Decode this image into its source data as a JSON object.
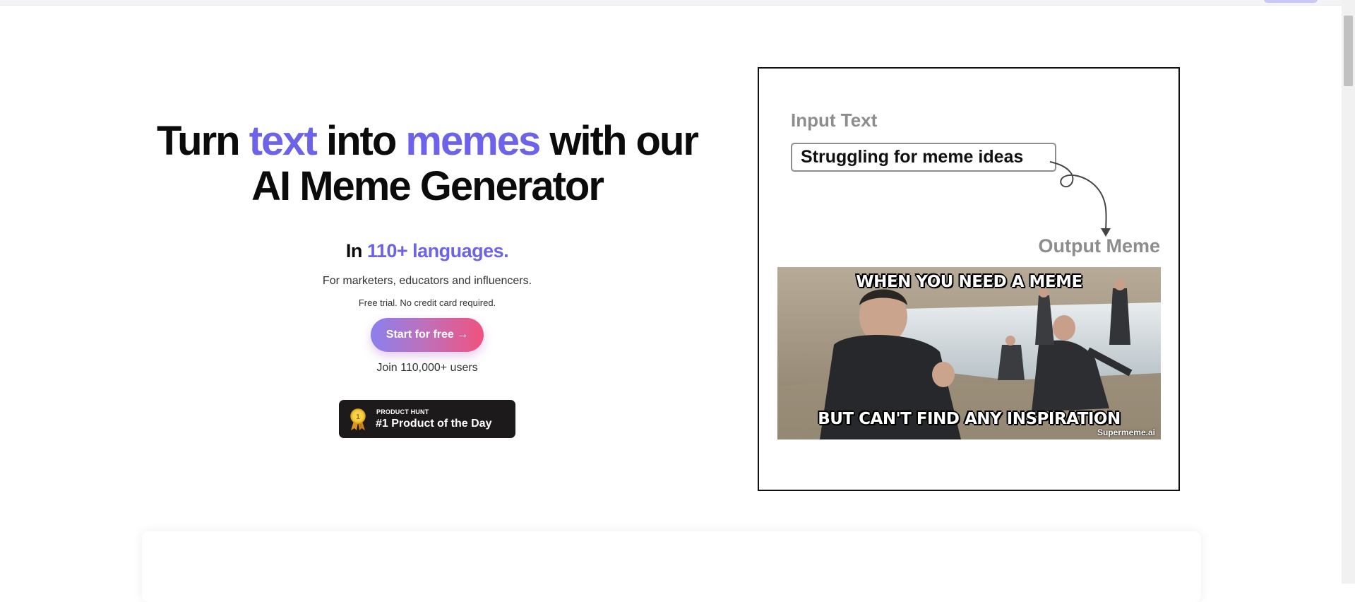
{
  "hero": {
    "headline": {
      "part1": "Turn ",
      "accent1": "text",
      "part2": " into ",
      "accent2": "memes",
      "part3": " with our",
      "line2": "AI Meme Generator"
    },
    "subhead": {
      "prefix": "In ",
      "accent": "110+ languages."
    },
    "audience": "For marketers, educators and influencers.",
    "trial_note": "Free trial. No credit card required.",
    "cta_label": "Start for free →",
    "users_note": "Join 110,000+ users",
    "badge": {
      "small": "PRODUCT HUNT",
      "big": "#1 Product of the Day",
      "medal_number": "1"
    }
  },
  "demo": {
    "input_label": "Input Text",
    "input_value": "Struggling for meme ideas",
    "output_label": "Output Meme",
    "meme_top": "WHEN YOU NEED A MEME",
    "meme_bottom": "BUT CAN'T FIND ANY INSPIRATION",
    "watermark": "Supermeme.ai"
  },
  "colors": {
    "accent": "#6c63e8",
    "cta_gradient_start": "#8a80ee",
    "cta_gradient_end": "#f0527e",
    "badge_bg": "#1d1a1c",
    "demo_label_gray": "#8d8d8d"
  },
  "icons": {
    "arrow": "right-arrow",
    "medal": "gold-medal-icon",
    "curved_arrow": "curved-arrow-icon"
  }
}
